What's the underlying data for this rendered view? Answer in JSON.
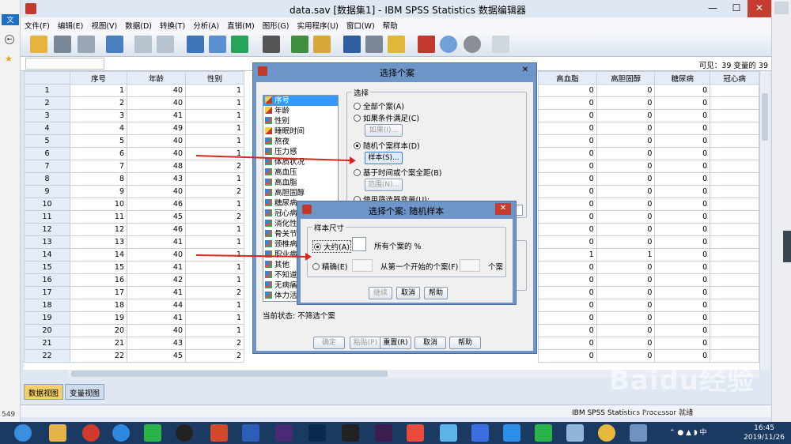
{
  "window": {
    "title": "data.sav [数据集1] - IBM SPSS Statistics 数据编辑器"
  },
  "left_strip": {
    "items": [
      "文",
      "549"
    ]
  },
  "menu": [
    "文件(F)",
    "编辑(E)",
    "视图(V)",
    "数据(D)",
    "转换(T)",
    "分析(A)",
    "直销(M)",
    "图形(G)",
    "实用程序(U)",
    "窗口(W)",
    "帮助"
  ],
  "cellbar": {
    "visible": "可见：39 变量的 39"
  },
  "grid": {
    "columns_left": [
      "序号",
      "年龄",
      "性别"
    ],
    "columns_right": [
      "高血脂",
      "高胆固醇",
      "糖尿病",
      "冠心病"
    ],
    "rows": [
      {
        "id": "1",
        "seq": "1",
        "age": "40",
        "sex": "1",
        "r": [
          "0",
          "0",
          "0",
          ""
        ]
      },
      {
        "id": "2",
        "seq": "2",
        "age": "40",
        "sex": "1",
        "r": [
          "0",
          "0",
          "0",
          ""
        ]
      },
      {
        "id": "3",
        "seq": "3",
        "age": "41",
        "sex": "1",
        "r": [
          "0",
          "0",
          "0",
          ""
        ]
      },
      {
        "id": "4",
        "seq": "4",
        "age": "49",
        "sex": "1",
        "r": [
          "0",
          "0",
          "0",
          ""
        ]
      },
      {
        "id": "5",
        "seq": "5",
        "age": "40",
        "sex": "1",
        "r": [
          "0",
          "0",
          "0",
          ""
        ]
      },
      {
        "id": "6",
        "seq": "6",
        "age": "40",
        "sex": "1",
        "r": [
          "0",
          "0",
          "0",
          ""
        ]
      },
      {
        "id": "7",
        "seq": "7",
        "age": "48",
        "sex": "2",
        "r": [
          "0",
          "0",
          "0",
          ""
        ]
      },
      {
        "id": "8",
        "seq": "8",
        "age": "43",
        "sex": "1",
        "r": [
          "0",
          "0",
          "0",
          ""
        ]
      },
      {
        "id": "9",
        "seq": "9",
        "age": "40",
        "sex": "2",
        "r": [
          "0",
          "0",
          "0",
          ""
        ]
      },
      {
        "id": "10",
        "seq": "10",
        "age": "46",
        "sex": "1",
        "r": [
          "0",
          "0",
          "0",
          ""
        ]
      },
      {
        "id": "11",
        "seq": "11",
        "age": "45",
        "sex": "2",
        "r": [
          "0",
          "0",
          "0",
          ""
        ]
      },
      {
        "id": "12",
        "seq": "12",
        "age": "46",
        "sex": "1",
        "r": [
          "0",
          "0",
          "0",
          ""
        ]
      },
      {
        "id": "13",
        "seq": "13",
        "age": "41",
        "sex": "1",
        "r": [
          "0",
          "0",
          "0",
          ""
        ]
      },
      {
        "id": "14",
        "seq": "14",
        "age": "40",
        "sex": "1",
        "r": [
          "1",
          "1",
          "0",
          ""
        ]
      },
      {
        "id": "15",
        "seq": "15",
        "age": "41",
        "sex": "1",
        "r": [
          "0",
          "0",
          "0",
          ""
        ]
      },
      {
        "id": "16",
        "seq": "16",
        "age": "42",
        "sex": "1",
        "r": [
          "0",
          "0",
          "0",
          ""
        ]
      },
      {
        "id": "17",
        "seq": "17",
        "age": "41",
        "sex": "2",
        "r": [
          "0",
          "0",
          "0",
          ""
        ]
      },
      {
        "id": "18",
        "seq": "18",
        "age": "44",
        "sex": "1",
        "r": [
          "0",
          "0",
          "0",
          ""
        ]
      },
      {
        "id": "19",
        "seq": "19",
        "age": "41",
        "sex": "1",
        "r": [
          "0",
          "0",
          "0",
          ""
        ]
      },
      {
        "id": "20",
        "seq": "20",
        "age": "40",
        "sex": "1",
        "r": [
          "0",
          "0",
          "0",
          ""
        ]
      },
      {
        "id": "21",
        "seq": "21",
        "age": "43",
        "sex": "2",
        "r": [
          "0",
          "0",
          "0",
          ""
        ]
      },
      {
        "id": "22",
        "seq": "22",
        "age": "45",
        "sex": "2",
        "r": [
          "0",
          "0",
          "0",
          ""
        ]
      }
    ]
  },
  "tabs": {
    "data_view": "数据视图",
    "variable_view": "变量视图"
  },
  "status": {
    "processor": "IBM SPSS Statistics Processor 就绪"
  },
  "select_dialog": {
    "title": "选择个案",
    "variables": [
      {
        "label": "序号",
        "icon": "ruler"
      },
      {
        "label": "年龄",
        "icon": "ruler"
      },
      {
        "label": "性别",
        "icon": "nominal"
      },
      {
        "label": "睡眠时间",
        "icon": "ruler"
      },
      {
        "label": "熬夜",
        "icon": "nominal"
      },
      {
        "label": "压力感",
        "icon": "nominal"
      },
      {
        "label": "体质状况",
        "icon": "nominal"
      },
      {
        "label": "高血压",
        "icon": "nominal"
      },
      {
        "label": "高血脂",
        "icon": "nominal"
      },
      {
        "label": "高胆固醇",
        "icon": "nominal"
      },
      {
        "label": "糖尿病",
        "icon": "nominal"
      },
      {
        "label": "冠心病",
        "icon": "nominal"
      },
      {
        "label": "消化性",
        "icon": "nominal"
      },
      {
        "label": "骨关节",
        "icon": "nominal"
      },
      {
        "label": "颈椎病",
        "icon": "nominal"
      },
      {
        "label": "职业病",
        "icon": "nominal"
      },
      {
        "label": "其他",
        "icon": "nominal"
      },
      {
        "label": "不知道",
        "icon": "nominal"
      },
      {
        "label": "无病痛",
        "icon": "nominal"
      },
      {
        "label": "体力活",
        "icon": "nominal"
      }
    ],
    "group_label": "选择",
    "options": {
      "all": "全部个案(A)",
      "if": "如果条件满足(C)",
      "if_btn": "如果(I)...",
      "random": "随机个案样本(D)",
      "sample_btn": "样本(S)...",
      "range": "基于时间或个案全距(B)",
      "range_btn": "范围(N)...",
      "filter": "使用筛选器变量(U):"
    },
    "current_status": "当前状态: 不筛选个案",
    "buttons": {
      "ok": "确定",
      "paste": "粘贴(P)",
      "reset": "重置(R)",
      "cancel": "取消",
      "help": "帮助"
    }
  },
  "random_dialog": {
    "title": "选择个案: 随机样本",
    "group_label": "样本尺寸",
    "approx": "大约(A)",
    "approx_suffix": "所有个案的 %",
    "exact": "精确(E)",
    "exact_mid": "从第一个开始的个案(F)",
    "exact_suffix": "个案",
    "buttons": {
      "continue": "继续",
      "cancel": "取消",
      "help": "帮助"
    }
  },
  "taskbar": {
    "time": "16:45",
    "date": "2019/11/26"
  },
  "watermark": {
    "text": "Baidu经验",
    "url": "jingyan.baidu.com"
  }
}
